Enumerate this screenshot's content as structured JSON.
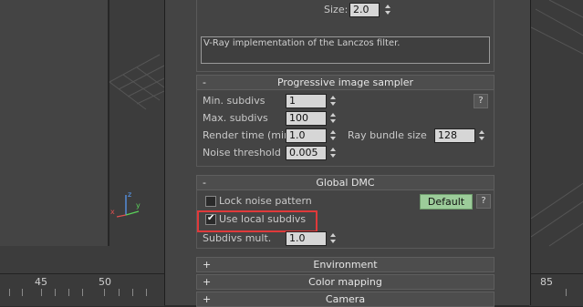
{
  "filter": {
    "size_label": "Size:",
    "size_value": "2.0",
    "description": "V-Ray implementation of the Lanczos filter."
  },
  "progressive": {
    "header_sign": "-",
    "title": "Progressive image sampler",
    "min_subdivs_label": "Min. subdivs",
    "min_subdivs_value": "1",
    "max_subdivs_label": "Max. subdivs",
    "max_subdivs_value": "100",
    "render_time_label": "Render time (min)",
    "render_time_value": "1.0",
    "ray_bundle_label": "Ray bundle size",
    "ray_bundle_value": "128",
    "noise_threshold_label": "Noise threshold",
    "noise_threshold_value": "0.005",
    "help_label": "?"
  },
  "global_dmc": {
    "header_sign": "-",
    "title": "Global DMC",
    "lock_noise_label": "Lock noise pattern",
    "lock_noise_checked": false,
    "default_button": "Default",
    "help_label": "?",
    "use_local_label": "Use local subdivs",
    "use_local_checked": true,
    "subdivs_mult_label": "Subdivs mult.",
    "subdivs_mult_value": "1.0"
  },
  "collapsed_rollouts": [
    {
      "sign": "+",
      "title": "Environment"
    },
    {
      "sign": "+",
      "title": "Color mapping"
    },
    {
      "sign": "+",
      "title": "Camera"
    }
  ],
  "ruler_left": [
    "45",
    "50"
  ],
  "ruler_right": [
    "85"
  ],
  "colors": {
    "highlight": "#e0393a",
    "default_button": "#9ccc9a"
  }
}
